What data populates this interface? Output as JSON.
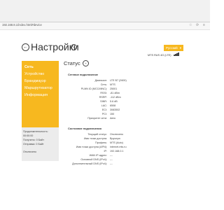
{
  "browser": {
    "url": "192.168.8.1/index.html#device"
  },
  "header": {
    "title": "Настройки",
    "language_button": "Русский",
    "operator": "MTS RUS 4G (LTE)"
  },
  "sidebar": {
    "items": [
      {
        "label": "Сеть"
      },
      {
        "label": "Устройство"
      },
      {
        "label": "Брандмауэр"
      },
      {
        "label": "Маршрутизатор"
      },
      {
        "label": "Информация"
      }
    ],
    "stats": {
      "duration_label": "Продолжительность:",
      "duration_value": "00:00:00",
      "received": "Получено: 0 Байт",
      "sent": "Отправка: 0 Байт",
      "status": "Отключено"
    }
  },
  "main": {
    "section_title": "Статус",
    "network_group": {
      "title": "Сетевое подключение",
      "rows": [
        {
          "label": "Диапазон:",
          "value": "LTE B7 (2600)"
        },
        {
          "label": "Сеть:",
          "value": "MTS"
        },
        {
          "label": "PLMN ID (MCC/MNC):",
          "value": "25001"
        },
        {
          "label": "RSSI:",
          "value": "-81 dBm"
        },
        {
          "label": "RSRP:",
          "value": "-112 dBm"
        },
        {
          "label": "SINR:",
          "value": "5.6 dB"
        },
        {
          "label": "LAC:",
          "value": "6508"
        },
        {
          "label": "ECI:",
          "value": "3083502"
        },
        {
          "label": "PCI:",
          "value": "150"
        },
        {
          "label": "Приоритет сети:",
          "value": "Авто"
        }
      ]
    },
    "connection_group": {
      "title": "Состояние подключения",
      "rows": [
        {
          "label": "Текущий статус:",
          "value": "Отключено"
        },
        {
          "label": "Имя точки доступа:",
          "value": "Вручную"
        },
        {
          "label": "Профиль:",
          "value": "MTS (Auto)"
        },
        {
          "label": "Имя точки доступа (APN):",
          "value": "internet.mts.ru"
        },
        {
          "label": "IP:",
          "value": "192.168.0.1"
        },
        {
          "label": "WAN IP-адрес:",
          "value": "---"
        },
        {
          "label": "Основной DNS (IPv4):",
          "value": "---"
        },
        {
          "label": "Дополнительный DNS (IPv4):",
          "value": "---"
        }
      ]
    }
  }
}
